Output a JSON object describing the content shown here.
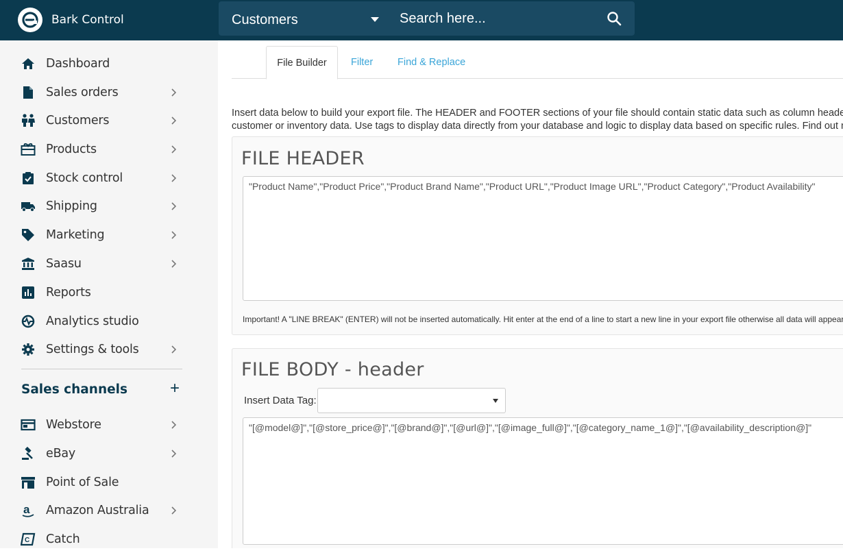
{
  "app": {
    "name": "Bark Control"
  },
  "search": {
    "scope": "Customers",
    "placeholder": "Search here..."
  },
  "sidebar": {
    "items": [
      {
        "label": "Dashboard",
        "icon": "home-icon",
        "chevron": false
      },
      {
        "label": "Sales orders",
        "icon": "document-icon",
        "chevron": true
      },
      {
        "label": "Customers",
        "icon": "people-icon",
        "chevron": true
      },
      {
        "label": "Products",
        "icon": "gift-box-icon",
        "chevron": true
      },
      {
        "label": "Stock control",
        "icon": "clipboard-check-icon",
        "chevron": true
      },
      {
        "label": "Shipping",
        "icon": "truck-icon",
        "chevron": true
      },
      {
        "label": "Marketing",
        "icon": "tag-icon",
        "chevron": true
      },
      {
        "label": "Saasu",
        "icon": "bank-icon",
        "chevron": true
      },
      {
        "label": "Reports",
        "icon": "bar-chart-icon",
        "chevron": false
      },
      {
        "label": "Analytics studio",
        "icon": "analytics-icon",
        "chevron": false
      },
      {
        "label": "Settings & tools",
        "icon": "gear-icon",
        "chevron": true
      }
    ],
    "channels_title": "Sales channels",
    "channels_add": "+",
    "channels": [
      {
        "label": "Webstore",
        "icon": "browser-window-icon",
        "chevron": true
      },
      {
        "label": "eBay",
        "icon": "gavel-icon",
        "chevron": true
      },
      {
        "label": "Point of Sale",
        "icon": "storefront-icon",
        "chevron": false
      },
      {
        "label": "Amazon Australia",
        "icon": "amazon-icon",
        "chevron": true
      },
      {
        "label": "Catch",
        "icon": "catch-icon",
        "chevron": false
      }
    ]
  },
  "tabs": [
    {
      "label": "File Builder",
      "active": true
    },
    {
      "label": "Filter",
      "active": false
    },
    {
      "label": "Find & Replace",
      "active": false
    }
  ],
  "intro": {
    "line1": "Insert data below to build your export file. The HEADER and FOOTER sections of your file should contain static data such as column headers",
    "line2": "customer or inventory data. Use tags to display data directly from your database and logic to display data based on specific rules. Find out more"
  },
  "file_header": {
    "title": "FILE HEADER",
    "content": "\"Product Name\",\"Product Price\",\"Product Brand Name\",\"Product URL\",\"Product Image URL\",\"Product Category\",\"Product Availability\"",
    "note": "Important! A \"LINE BREAK\" (ENTER) will not be inserted automatically. Hit enter at the end of a line to start a new line in your export file otherwise all data will appear"
  },
  "file_body": {
    "title": "FILE BODY - header",
    "tag_label": "Insert Data Tag:",
    "tag_value": "",
    "content": "\"[@model@]\",\"[@store_price@]\",\"[@brand@]\",\"[@url@]\",\"[@image_full@]\",\"[@category_name_1@]\",\"[@availability_description@]\""
  },
  "colors": {
    "topbar": "#0b3a4f",
    "search_bg": "#1a4a63",
    "link": "#3aa5d8",
    "sidebar_bg": "#f5f5f5"
  }
}
